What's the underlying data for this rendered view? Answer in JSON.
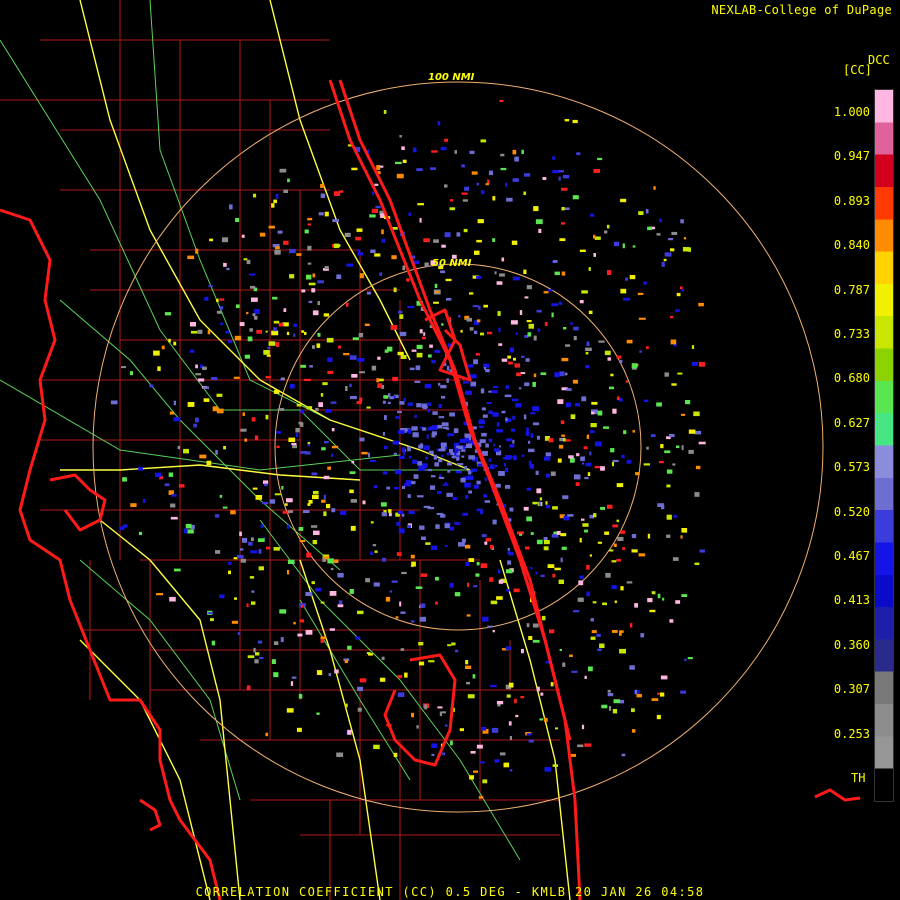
{
  "header": {
    "credit": "NEXLAB-College of DuPage"
  },
  "footer": {
    "product": "CORRELATION COEFFICIENT (CC) 0.5 DEG - KMLB 20 JAN 26 04:58"
  },
  "rings": [
    {
      "label": "100 NMI",
      "radius_nmi": 100
    },
    {
      "label": "50 NMI",
      "radius_nmi": 50
    }
  ],
  "legend": {
    "code": "DCC",
    "unit": "[CC]",
    "ticks": [
      "1.000",
      "0.947",
      "0.893",
      "0.840",
      "0.787",
      "0.733",
      "0.680",
      "0.627",
      "0.573",
      "0.520",
      "0.467",
      "0.413",
      "0.360",
      "0.307",
      "0.253"
    ],
    "threshold_label": "TH",
    "colors": [
      "#ffb6e1",
      "#e0629a",
      "#d2001e",
      "#ff3a00",
      "#ff8c00",
      "#ffd200",
      "#f0f000",
      "#c8e600",
      "#8cd200",
      "#5ae650",
      "#46e682",
      "#8c8cdc",
      "#6e6ed2",
      "#3c3cdc",
      "#1414e6",
      "#0a0ac8",
      "#1e1eaa",
      "#2a2a8c",
      "#787878",
      "#8c8c8c",
      "#969696",
      "#000000"
    ]
  },
  "colors": {
    "coast": "#ff1a1a",
    "county": "#b01818",
    "highway": "#ffff40",
    "road": "#60e060",
    "ring": "#f0b070",
    "text": "#ffff00"
  }
}
